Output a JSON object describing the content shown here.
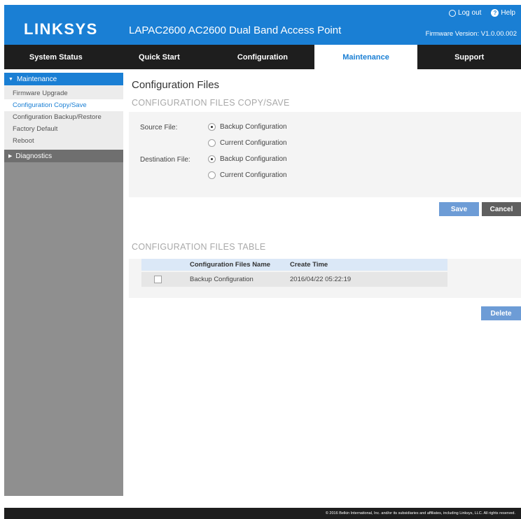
{
  "header": {
    "logo": "LINKSYS",
    "product": "LAPAC2600 AC2600 Dual Band Access Point",
    "logout": "Log out",
    "help": "Help",
    "help_glyph": "?",
    "firmware": "Firmware Version: V1.0.00.002"
  },
  "nav": {
    "tabs": [
      {
        "label": "System Status"
      },
      {
        "label": "Quick Start"
      },
      {
        "label": "Configuration"
      },
      {
        "label": "Maintenance",
        "active": true
      },
      {
        "label": "Support"
      }
    ]
  },
  "sidebar": {
    "maintenance_label": "Maintenance",
    "caret_down": "▼",
    "caret_right": "▶",
    "items": [
      {
        "label": "Firmware Upgrade"
      },
      {
        "label": "Configuration Copy/Save",
        "current": true
      },
      {
        "label": "Configuration Backup/Restore"
      },
      {
        "label": "Factory Default"
      },
      {
        "label": "Reboot"
      }
    ],
    "diagnostics_label": "Diagnostics"
  },
  "main": {
    "page_title": "Configuration Files",
    "copy_section_title": "CONFIGURATION FILES COPY/SAVE",
    "source_label": "Source File:",
    "destination_label": "Destination File:",
    "source_options": [
      {
        "label": "Backup Configuration",
        "selected": true
      },
      {
        "label": "Current Configuration",
        "selected": false
      }
    ],
    "destination_options": [
      {
        "label": "Backup Configuration",
        "selected": true
      },
      {
        "label": "Current Configuration",
        "selected": false
      }
    ],
    "save_label": "Save",
    "cancel_label": "Cancel",
    "table_section_title": "CONFIGURATION FILES TABLE",
    "table": {
      "columns": [
        "",
        "Configuration Files Name",
        "Create Time"
      ],
      "rows": [
        {
          "checked": false,
          "name": "Backup Configuration",
          "time": "2016/04/22 05:22:19"
        }
      ]
    },
    "delete_label": "Delete"
  },
  "footer": {
    "text": "© 2016 Belkin International, Inc. and/or its subsidiaries and affiliates, including Linksys, LLC. All rights reserved."
  },
  "colors": {
    "brand_blue": "#1a7fd4",
    "nav_dark": "#1e1e1e",
    "sidebar_gray": "#8f8f8f",
    "button_blue": "#6d9cd6",
    "button_gray": "#5f5f5f"
  },
  "icons": {
    "logout": "power-icon",
    "help": "help-icon"
  }
}
